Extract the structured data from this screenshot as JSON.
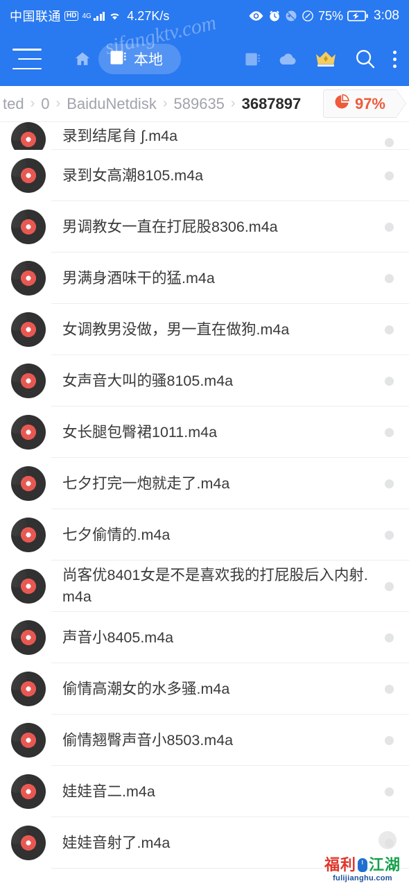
{
  "statusbar": {
    "carrier": "中国联通",
    "hd_badge": "HD",
    "network_type": "4G",
    "net_speed": "4.27K/s",
    "battery_percent": "75%",
    "clock": "3:08",
    "icons": [
      "eye-icon",
      "alarm-clock-icon",
      "mute-icon",
      "dnd-icon",
      "battery-charging-icon"
    ]
  },
  "toolbar": {
    "menu_icon": "hamburger-menu-icon",
    "home_icon": "home-icon",
    "local_tab_label": "本地",
    "local_tab_icon": "sdcard-icon",
    "sdcard_icon": "sdcard-icon",
    "cloud_icon": "cloud-icon",
    "vip_icon": "crown-icon",
    "search_icon": "search-icon",
    "overflow_icon": "overflow-menu-icon"
  },
  "breadcrumb": {
    "separator": "›",
    "items": [
      {
        "label": "ted",
        "current": false
      },
      {
        "label": "0",
        "current": false
      },
      {
        "label": "BaiduNetdisk",
        "current": false
      },
      {
        "label": "589635",
        "current": false
      },
      {
        "label": "3687897",
        "current": true
      }
    ],
    "storage": {
      "icon": "pie-chart-icon",
      "percent": "97%"
    }
  },
  "file_list": {
    "items": [
      {
        "name": "录到结尾䏍 ʃ.m4a",
        "icon": "vinyl-record-icon",
        "clipped": true
      },
      {
        "name": "录到女高潮8105.m4a",
        "icon": "vinyl-record-icon"
      },
      {
        "name": "男调教女一直在打屁股8306.m4a",
        "icon": "vinyl-record-icon"
      },
      {
        "name": "男满身酒味干的猛.m4a",
        "icon": "vinyl-record-icon"
      },
      {
        "name": "女调教男没做，男一直在做狗.m4a",
        "icon": "vinyl-record-icon"
      },
      {
        "name": "女声音大叫的骚8105.m4a",
        "icon": "vinyl-record-icon"
      },
      {
        "name": "女长腿包臀裙1011.m4a",
        "icon": "vinyl-record-icon"
      },
      {
        "name": "七夕打完一炮就走了.m4a",
        "icon": "vinyl-record-icon"
      },
      {
        "name": "七夕偷情的.m4a",
        "icon": "vinyl-record-icon"
      },
      {
        "name": "尚客优8401女是不是喜欢我的打屁股后入内射.m4a",
        "icon": "vinyl-record-icon"
      },
      {
        "name": "声音小8405.m4a",
        "icon": "vinyl-record-icon"
      },
      {
        "name": "偷情高潮女的水多骚.m4a",
        "icon": "vinyl-record-icon"
      },
      {
        "name": "偷情翘臀声音小8503.m4a",
        "icon": "vinyl-record-icon"
      },
      {
        "name": "娃娃音二.m4a",
        "icon": "vinyl-record-icon"
      },
      {
        "name": "娃娃音射了.m4a",
        "icon": "vinyl-record-icon"
      }
    ],
    "row_action_icon": "more-options-dot"
  },
  "watermarks": {
    "top": "sifangktv.com",
    "brand_left": "福利",
    "brand_right": "江湖",
    "brand_domain": "fulijianghu.com"
  },
  "colors": {
    "primary": "#2979f0",
    "accent_red": "#ef5a3c",
    "vinyl_label": "#e8554f",
    "text": "#3a3a3a",
    "muted": "#a0a4ab"
  }
}
